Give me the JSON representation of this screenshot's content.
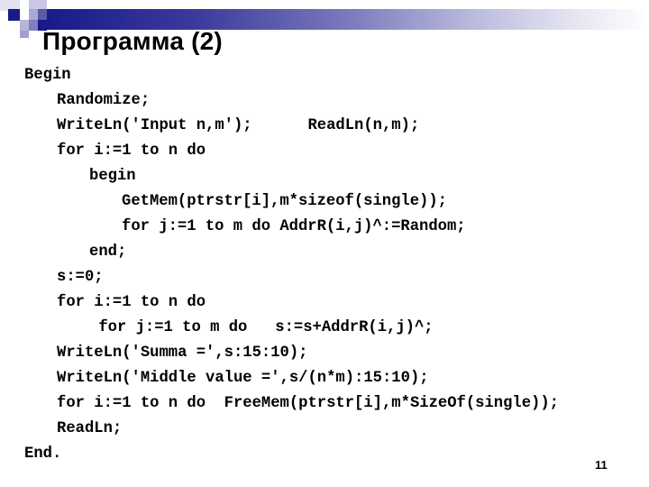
{
  "slide": {
    "title": "Программа (2)",
    "page_number": "11",
    "accent_color": "#1a1a8a",
    "code_lines": [
      {
        "indent": 0,
        "text": "Begin"
      },
      {
        "indent": 1,
        "text": "Randomize;"
      },
      {
        "indent": 1,
        "text": "WriteLn('Input n,m');      ReadLn(n,m);"
      },
      {
        "indent": 1,
        "text": "for i:=1 to n do"
      },
      {
        "indent": 2,
        "text": "begin"
      },
      {
        "indent": 3,
        "text": "GetMem(ptrstr[i],m*sizeof(single));"
      },
      {
        "indent": 3,
        "text": "for j:=1 to m do AddrR(i,j)^:=Random;"
      },
      {
        "indent": 2,
        "text": "end;"
      },
      {
        "indent": 1,
        "text": "s:=0;"
      },
      {
        "indent": 1,
        "text": "for i:=1 to n do"
      },
      {
        "indent": 2,
        "text": " for j:=1 to m do   s:=s+AddrR(i,j)^;"
      },
      {
        "indent": 1,
        "text": "WriteLn('Summa =',s:15:10);"
      },
      {
        "indent": 1,
        "text": "WriteLn('Middle value =',s/(n*m):15:10);"
      },
      {
        "indent": 1,
        "text": "for i:=1 to n do  FreeMem(ptrstr[i],m*SizeOf(single));"
      },
      {
        "indent": 1,
        "text": "ReadLn;"
      },
      {
        "indent": 0,
        "text": "End."
      }
    ]
  }
}
